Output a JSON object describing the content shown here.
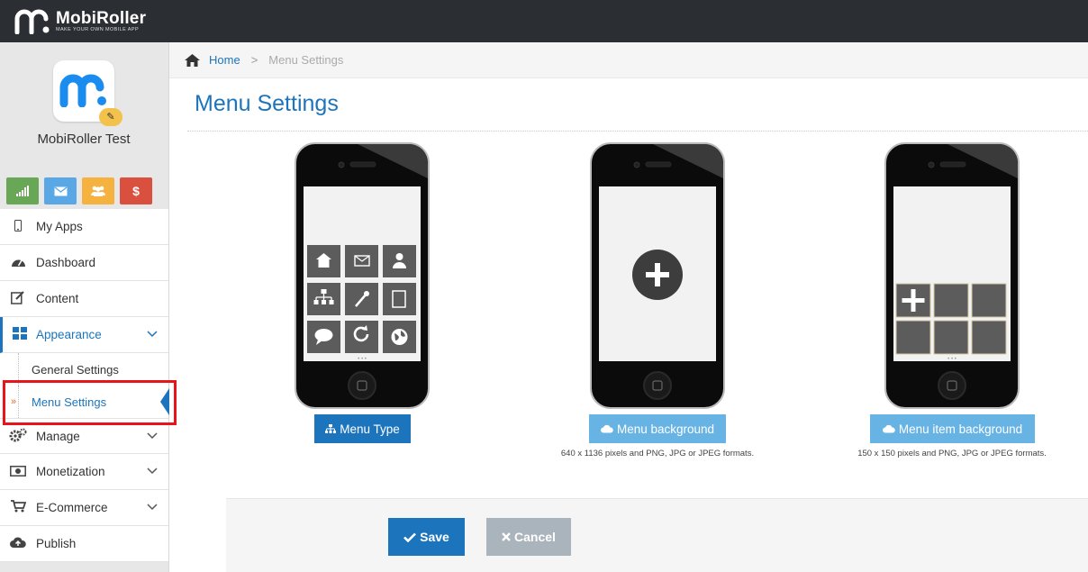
{
  "topbar": {
    "brand": "MobiRoller",
    "tagline": "MAKE YOUR OWN MOBILE APP",
    "bg": "#2b2e33"
  },
  "app": {
    "name": "MobiRoller Test"
  },
  "quick_buttons": [
    {
      "icon": "signal-icon",
      "color": "#67a756"
    },
    {
      "icon": "mail-icon",
      "color": "#5aa7e6"
    },
    {
      "icon": "users-icon",
      "color": "#f6b23f"
    },
    {
      "icon": "dollar-icon",
      "color": "#d9503e"
    }
  ],
  "menu": {
    "my_apps": "My Apps",
    "dashboard": "Dashboard",
    "content": "Content",
    "appearance": "Appearance",
    "general_settings": "General Settings",
    "menu_settings": "Menu Settings",
    "manage": "Manage",
    "monetization": "Monetization",
    "ecommerce": "E-Commerce",
    "publish": "Publish"
  },
  "breadcrumb": {
    "home": "Home",
    "separator": ">",
    "current": "Menu Settings"
  },
  "page": {
    "title": "Menu Settings"
  },
  "panels": {
    "menu_type": {
      "label": "Menu Type",
      "icon": "sitemap-icon"
    },
    "menu_background": {
      "label": "Menu background",
      "icon": "cloud-upload-icon",
      "hint": "640 x 1136 pixels and PNG, JPG or JPEG formats."
    },
    "menu_item_background": {
      "label": "Menu item background",
      "icon": "cloud-upload-icon",
      "hint": "150 x 150 pixels and PNG, JPG or JPEG formats."
    }
  },
  "footer": {
    "save": "Save",
    "cancel": "Cancel"
  },
  "colors": {
    "accent": "#1c75bc",
    "upload": "#67b3e4",
    "cancel": "#aab4bd",
    "highlight": "#e8141c"
  }
}
